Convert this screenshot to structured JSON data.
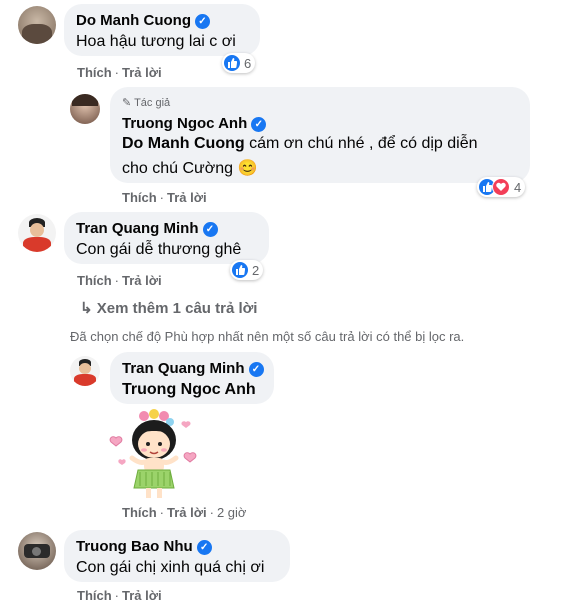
{
  "actions": {
    "like": "Thích",
    "dot": "·",
    "reply": "Trả lời"
  },
  "comments": [
    {
      "name": "Do Manh Cuong",
      "text": "Hoa hậu tương lai c ơi",
      "reaction_count": "6"
    },
    {
      "author_tag": "Tác giả",
      "name": "Truong Ngoc Anh",
      "mention": "Do Manh Cuong",
      "text_line1": " cám ơn chú nhé , để có dịp diễn",
      "text_line2": "cho chú Cường",
      "emoji": "😊",
      "reaction_count": "4"
    },
    {
      "name": "Tran Quang Minh",
      "text": "Con gái dễ thương ghê",
      "reaction_count": "2"
    },
    {
      "name": "Tran Quang Minh",
      "mention": "Truong Ngoc Anh",
      "time": "2 giờ"
    },
    {
      "name": "Truong Bao Nhu",
      "text": "Con gái chị xinh quá chị ơi"
    }
  ],
  "more_replies": "Xem thêm 1 câu trả lời",
  "filter_notice": "Đã chọn chế độ Phù hợp nhất nên một số câu trả lời có thể bị lọc ra.",
  "colors": {
    "bubble": "#f0f2f5",
    "link": "#1877f2",
    "muted": "#65676b",
    "heart": "#f33e58"
  }
}
